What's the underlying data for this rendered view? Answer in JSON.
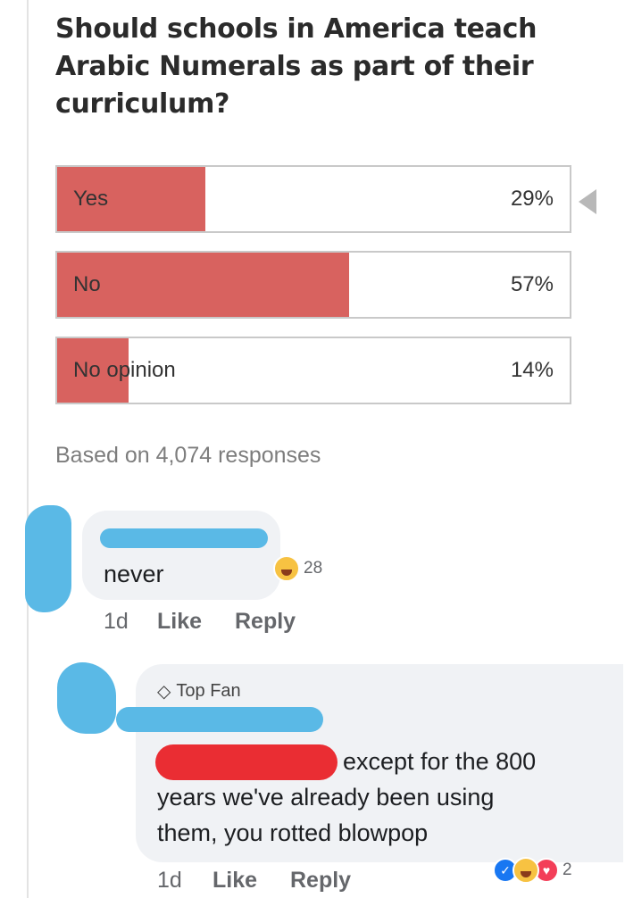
{
  "poll": {
    "question": "Should schools in America teach Arabic Numerals as part of their curriculum?",
    "options": [
      {
        "label": "Yes",
        "percent_text": "29%",
        "percent": 29
      },
      {
        "label": "No",
        "percent_text": "57%",
        "percent": 57
      },
      {
        "label": "No opinion",
        "percent_text": "14%",
        "percent": 14
      }
    ],
    "fill_color": "#d8625f",
    "responses_text": "Based on 4,074 responses"
  },
  "comments": [
    {
      "text": "never",
      "reaction_count": "28",
      "reaction_icon": "laughing-emoji-icon",
      "time": "1d",
      "like_label": "Like",
      "reply_label": "Reply"
    },
    {
      "badge": "Top Fan",
      "badge_icon": "diamond-icon",
      "text": "except for the 800 years we've already been using them, you rotted blowpop",
      "text_line1": "except for the 800",
      "text_line2": "years we've already been using",
      "text_line3": "them, you rotted blowpop",
      "reaction_count": "2",
      "reaction_icons": [
        "like-icon",
        "laughing-emoji-icon",
        "love-icon"
      ],
      "time": "1d",
      "like_label": "Like",
      "reply_label": "Reply"
    }
  ]
}
